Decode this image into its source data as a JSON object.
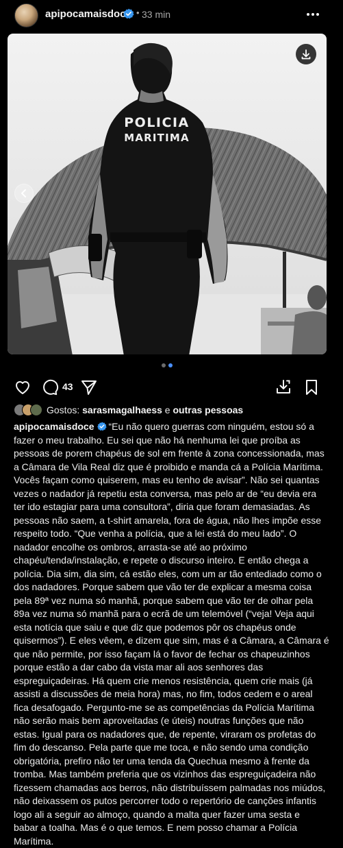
{
  "post": {
    "username": "apipocamaisdoce",
    "dot": "•",
    "time": "33 min"
  },
  "media": {
    "vest_text_line1": "POLICIA",
    "vest_text_line2": "MARITIMA",
    "carousel": {
      "count": 2,
      "active": 2
    }
  },
  "actions": {
    "comments_count": "43"
  },
  "likes": {
    "prefix": "Gostos:",
    "user": "sarasmagalhaess",
    "connector": "e",
    "others": "outras pessoas"
  },
  "caption": {
    "username": "apipocamaisdoce",
    "lines": [
      "“Eu não quero guerras com ninguém, estou só a",
      "fazer o meu trabalho. Eu sei que não há nenhuma lei que proíba as",
      "pessoas de porem chapéus de sol em frente à zona concessionada, mas",
      "a Câmara de Vila Real diz que é proibido e manda cá a Polícia Marítima.",
      "Vocês façam como quiserem, mas eu tenho de avisar”. Não sei quantas",
      "vezes o nadador já repetiu esta conversa, mas pelo ar de “eu devia era",
      "ter ido estagiar para uma consultora”, diria que foram demasiadas. As",
      "pessoas não saem, a t-shirt amarela, fora de água, não lhes impõe esse",
      "respeito todo. “Que venha a polícia, que a lei está do meu lado”. O",
      "nadador encolhe os ombros, arrasta-se até ao próximo",
      "chapéu/tenda/instalação, e repete o discurso inteiro. E então chega a",
      "polícia. Dia sim, dia sim, cá estão eles, com um ar tão entediado como o",
      "dos nadadores. Porque sabem que vão ter de explicar a mesma coisa",
      "pela 89ª vez numa só manhã, porque sabem que vão ter de olhar pela",
      "89a vez numa só manhã para o ecrã de um telemóvel (“veja! Veja aqui",
      "esta notícia que saiu e que diz que podemos pôr os chapéus onde",
      "quisermos”). E eles vêem, e dizem que sim, mas é a Câmara, a Câmara é",
      "que não permite, por isso façam lá o favor de fechar os chapeuzinhos",
      "porque estão a dar cabo da vista mar ali aos senhores das",
      "espreguiçadeiras. Há quem crie menos resistência, quem crie mais (já",
      "assisti a discussões de meia hora) mas, no fim, todos cedem e o areal",
      "fica desafogado. Pergunto-me se as competências da Polícia Marítima",
      "não serão mais bem aproveitadas (e úteis) noutras funções que não",
      "estas. Igual para os nadadores que, de repente, viraram os profetas do",
      "fim do descanso. Pela parte que me toca, e não sendo uma condição",
      "obrigatória, prefiro não ter uma tenda da Quechua mesmo à frente da",
      "tromba. Mas também preferia que os vizinhos das espreguiçadeira não",
      "fizessem chamadas aos berros, não distribuíssem palmadas nos miúdos,",
      "não deixassem os putos percorrer todo o repertório de canções infantis",
      "logo ali a seguir ao almoço, quando a malta quer fazer uma sesta e",
      "babar a toalha. Mas é o que temos. E nem posso chamar a Polícia",
      "Marítima."
    ]
  },
  "colors": {
    "background": "#000000",
    "text": "#f5f5f5",
    "muted": "#a8a8a8",
    "verified": "#3897f0",
    "dot_active": "#4a90ff",
    "dot_inactive": "#6b6b6b"
  },
  "icons": [
    "verified-badge-icon",
    "more-icon",
    "download-icon",
    "chevron-left-icon",
    "heart-icon",
    "comment-icon",
    "share-icon",
    "save-to-device-icon",
    "bookmark-icon"
  ]
}
